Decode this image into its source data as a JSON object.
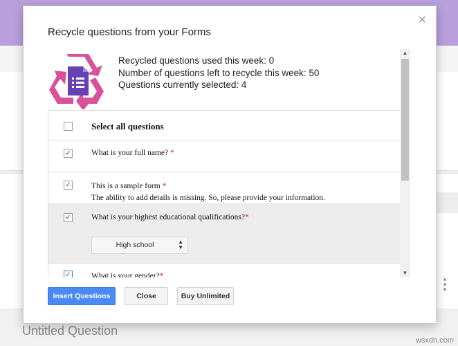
{
  "background": {
    "untitled_label": "Untitled Question",
    "watermark": "wsxdn.com"
  },
  "dialog": {
    "title": "Recycle questions from your Forms",
    "close_symbol": "×",
    "stats": {
      "used": "Recycled questions used this week: 0",
      "left": "Number of questions left to recycle this week: 50",
      "selected": "Questions currently selected: 4"
    },
    "select_all_label": "Select all questions",
    "questions": [
      {
        "text": "What is your full name?",
        "required": "*",
        "checked": true
      },
      {
        "text": "This is a sample form",
        "required": "*",
        "description": "The ability to add details is missing. So, please provide your information.",
        "checked": true
      },
      {
        "text": "What is your highest educational qualifications?",
        "required": "*",
        "checked": true,
        "dropdown_value": "High school"
      },
      {
        "text": "What is your gender?",
        "required": "*",
        "checked": true
      }
    ],
    "buttons": {
      "insert": "Insert Questions",
      "close": "Close",
      "buy": "Buy Unlimited"
    },
    "icons": {
      "checkmark": "✓",
      "scroll_up": "▲",
      "scroll_down": "▼",
      "dropdown_up": "▲",
      "dropdown_down": "▼"
    },
    "colors": {
      "primary_button": "#4a8af4",
      "recycle_logo": "#d9519b",
      "form_icon": "#6740b3",
      "required_star": "#d01f1f"
    }
  }
}
